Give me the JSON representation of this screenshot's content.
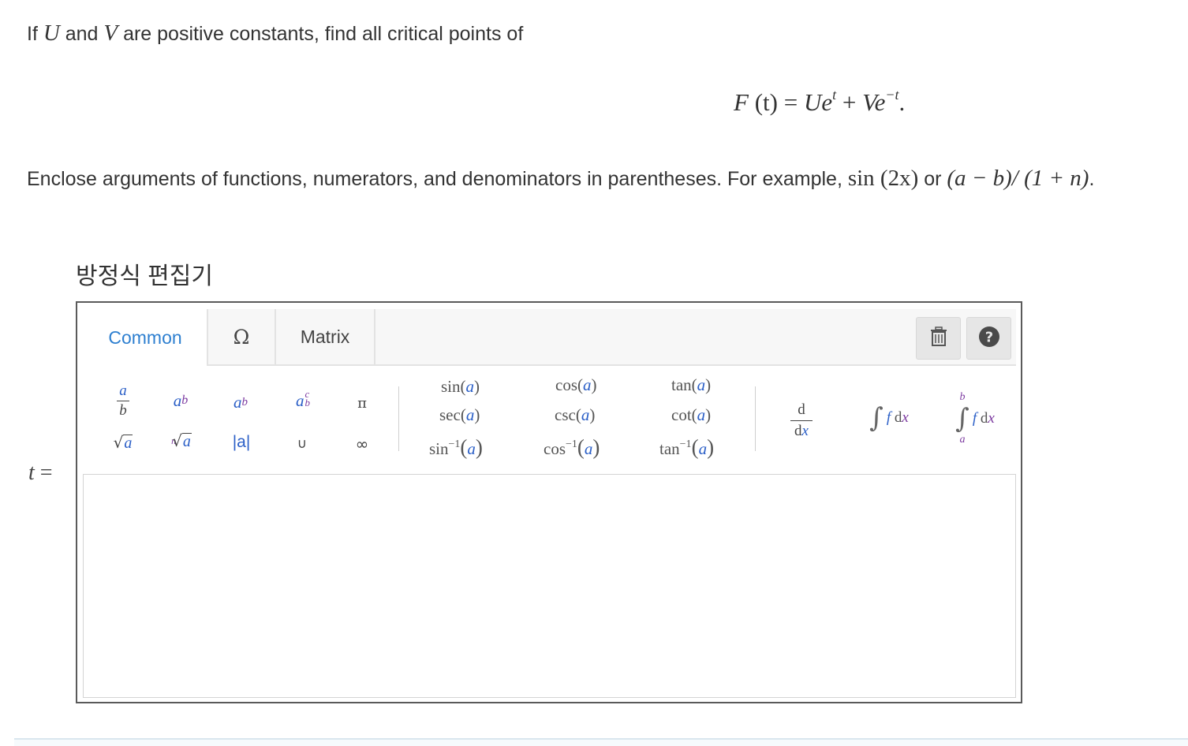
{
  "question": {
    "prefix": "If ",
    "var_u": "U",
    "and": " and ",
    "var_v": "V",
    "suffix": " are positive constants, find all critical points of"
  },
  "formula": {
    "lhs_f": "F",
    "lhs_arg": " (t) = ",
    "u": "U",
    "e1": "e",
    "exp1": "t",
    "plus": " + ",
    "v": "V",
    "e2": "e",
    "exp2": "−t",
    "end": "."
  },
  "instruction": {
    "text": "Enclose arguments of functions, numerators, and denominators in parentheses. For example, ",
    "example1": "sin (2x)",
    "or": " or ",
    "example2": "(a − b)/ (1 + n)",
    "end": "."
  },
  "editor": {
    "title": "방정식 편집기",
    "tabs": [
      "Common",
      "Ω",
      "Matrix"
    ],
    "active_tab": "Common",
    "accent_color": "#2d7fd0",
    "trash_icon": "trash-icon",
    "help_icon": "question-circle-icon"
  },
  "palette": {
    "fraction_num": "a",
    "fraction_den": "b",
    "power_base": "a",
    "power_exp": "b",
    "sub_base": "a",
    "sub_idx": "b",
    "subsup_base": "a",
    "subsup_sup": "c",
    "subsup_sub": "b",
    "pi": "π",
    "sqrt_arg": "a",
    "nroot_n": "n",
    "nroot_arg": "a",
    "abs": "|a|",
    "union": "∪",
    "infinity": "∞",
    "trig": {
      "sin": "sin",
      "cos": "cos",
      "tan": "tan",
      "sec": "sec",
      "csc": "csc",
      "cot": "cot",
      "arg": "a",
      "inv_exp": "−1"
    },
    "deriv_num": "d",
    "deriv_den_d": "d",
    "deriv_den_x": "x",
    "integral_f": "f",
    "integral_d": "d",
    "integral_x": "x",
    "def_upper": "b",
    "def_lower": "a"
  },
  "answer": {
    "var": "t",
    "equals": " ="
  }
}
